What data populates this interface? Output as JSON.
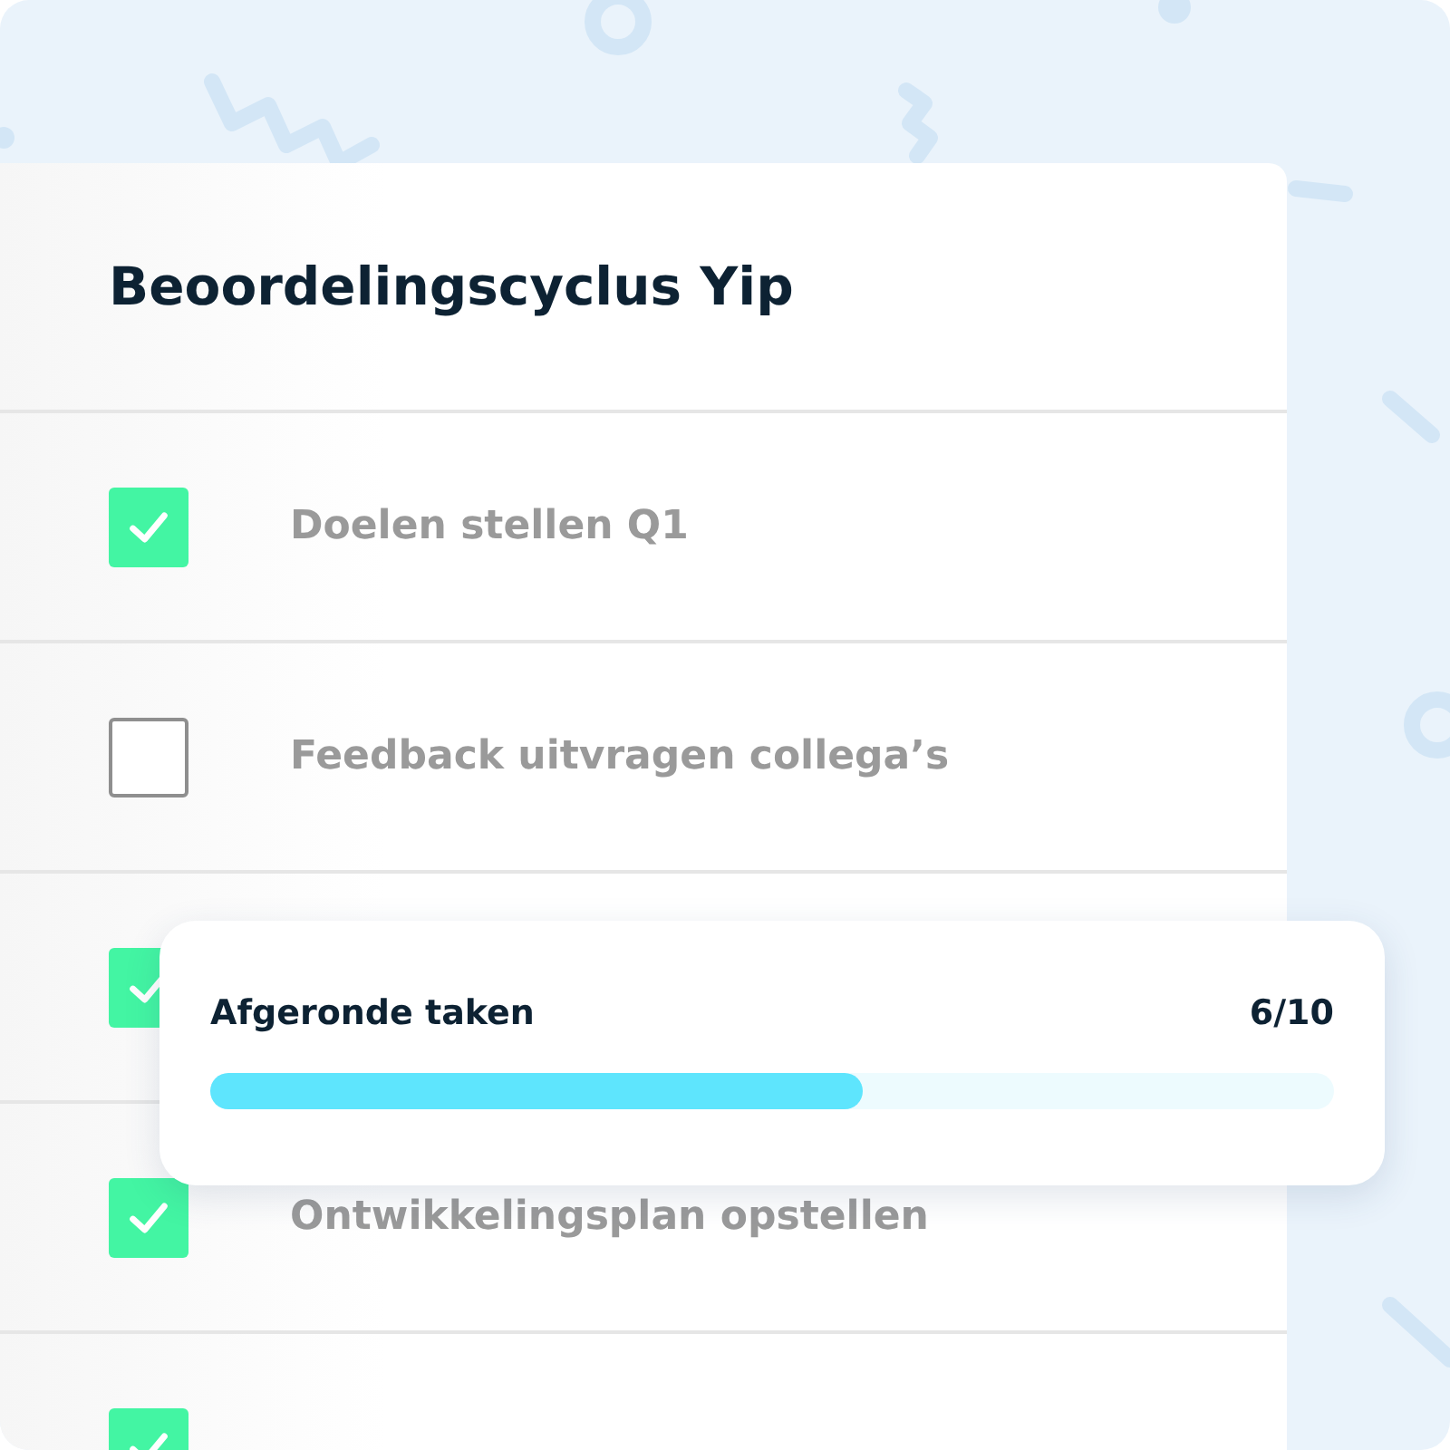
{
  "card": {
    "title": "Beoordelingscyclus Yip",
    "tasks": [
      {
        "label": "Doelen stellen Q1",
        "checked": true
      },
      {
        "label": "Feedback uitvragen collega’s",
        "checked": false
      },
      {
        "checked": true
      },
      {
        "label": "Ontwikkelingsplan opstellen",
        "checked": true
      },
      {
        "checked": true
      }
    ]
  },
  "progress": {
    "label": "Afgeronde taken",
    "count": "6/10",
    "level": 0.58
  }
}
